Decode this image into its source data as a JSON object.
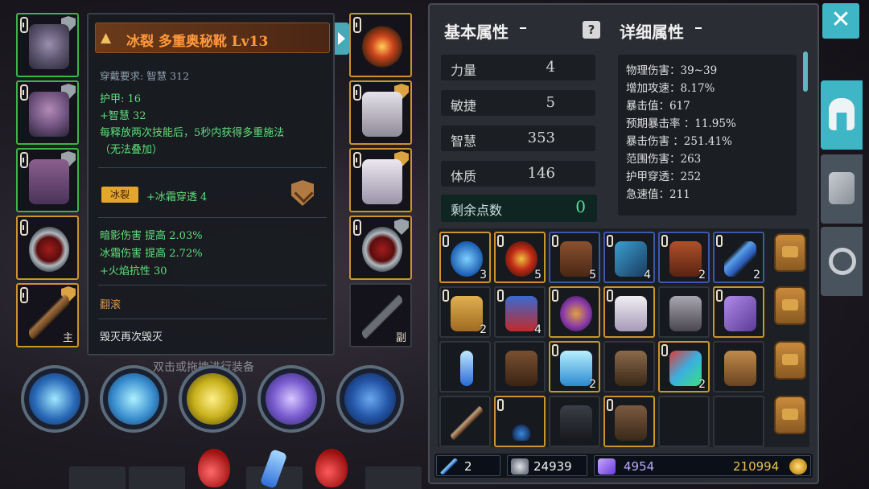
{
  "tooltip": {
    "title": "冰裂  多重奥秘靴  Lv13",
    "requirement": "穿戴要求:   智慧 312",
    "armor": "护甲:  16",
    "intellect": "+智慧 32",
    "passive_line1": "每释放两次技能后，5秒内获得多重施法",
    "passive_line2": "（无法叠加）",
    "rune_badge": "冰裂",
    "rune_effect": "+冰霜穿透  4",
    "bonus_shadow": "暗影伤害  提高  2.03%",
    "bonus_frost": "冰霜伤害  提高  2.72%",
    "bonus_fire_res": "+火焰抗性  30",
    "skill_name": "翻滚",
    "set_name": "毁灭再次毁灭"
  },
  "hint": "双击或拖拽进行装备",
  "equip_slots": {
    "main_hand_tag": "主",
    "off_hand_tag": "副"
  },
  "stats": {
    "basic_title": "基本属性",
    "detail_title": "详细属性",
    "rows": [
      {
        "label": "力量",
        "value": "4"
      },
      {
        "label": "敏捷",
        "value": "5"
      },
      {
        "label": "智慧",
        "value": "353"
      },
      {
        "label": "体质",
        "value": "146"
      }
    ],
    "remaining_label": "剩余点数",
    "remaining_value": "0",
    "details": [
      "物理伤害：39~39",
      "增加攻速：8.17%",
      "暴击值：617",
      "预期暴击率 ：11.95%",
      "暴击伤害 ：251.41%",
      "范围伤害：263",
      "护甲穿透：252",
      "急速值：211"
    ]
  },
  "inventory": {
    "counts": [
      "3",
      "5",
      "5",
      "4",
      "2",
      "2",
      "2",
      "4",
      "2",
      "2"
    ]
  },
  "currency": {
    "wands": "2",
    "silver": "24939",
    "crystal": "4954",
    "gold": "210994"
  },
  "colors": {
    "accent": "#3fb6c6",
    "legendary_border": "#c9952c",
    "set_border": "#39b54a",
    "title_orange": "#ff9a3c",
    "stat_green": "#5fe07a"
  },
  "icons": [
    "close-icon",
    "helmet-icon",
    "gloves-icon",
    "settings-icon",
    "question-icon",
    "gold-coin-icon"
  ]
}
